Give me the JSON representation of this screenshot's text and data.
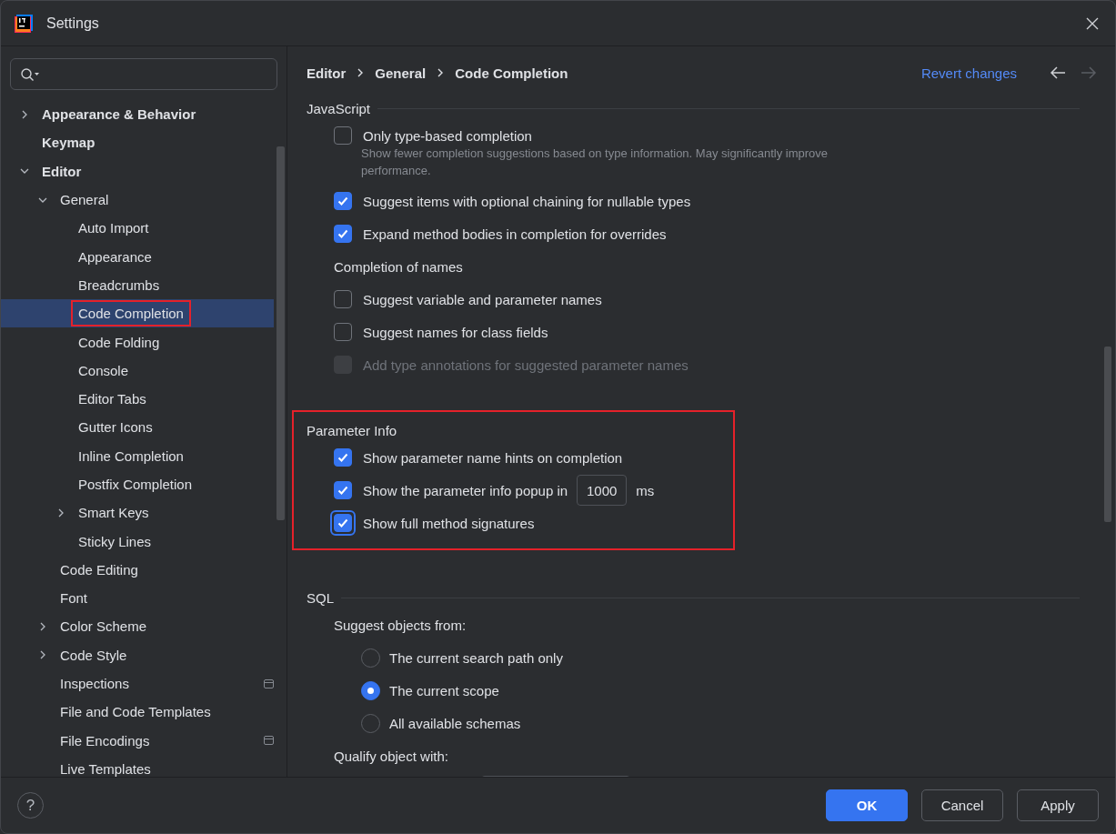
{
  "window": {
    "title": "Settings"
  },
  "sidebar": {
    "items": [
      {
        "label": "Appearance & Behavior",
        "selected": false,
        "highlighted": false,
        "project_scope": false,
        "expanded": false
      },
      {
        "label": "Keymap",
        "selected": false,
        "highlighted": false,
        "project_scope": false
      },
      {
        "label": "Editor",
        "selected": false,
        "highlighted": false,
        "project_scope": false,
        "expanded": true,
        "children": [
          {
            "label": "General",
            "selected": false,
            "highlighted": false,
            "project_scope": false,
            "expanded": true,
            "children": [
              {
                "label": "Auto Import",
                "selected": false,
                "highlighted": false,
                "project_scope": false
              },
              {
                "label": "Appearance",
                "selected": false,
                "highlighted": false,
                "project_scope": false
              },
              {
                "label": "Breadcrumbs",
                "selected": false,
                "highlighted": false,
                "project_scope": false
              },
              {
                "label": "Code Completion",
                "selected": true,
                "highlighted": true,
                "project_scope": false
              },
              {
                "label": "Code Folding",
                "selected": false,
                "highlighted": false,
                "project_scope": false
              },
              {
                "label": "Console",
                "selected": false,
                "highlighted": false,
                "project_scope": false
              },
              {
                "label": "Editor Tabs",
                "selected": false,
                "highlighted": false,
                "project_scope": false
              },
              {
                "label": "Gutter Icons",
                "selected": false,
                "highlighted": false,
                "project_scope": false
              },
              {
                "label": "Inline Completion",
                "selected": false,
                "highlighted": false,
                "project_scope": false
              },
              {
                "label": "Postfix Completion",
                "selected": false,
                "highlighted": false,
                "project_scope": false
              },
              {
                "label": "Smart Keys",
                "selected": false,
                "highlighted": false,
                "project_scope": false,
                "expanded": false
              },
              {
                "label": "Sticky Lines",
                "selected": false,
                "highlighted": false,
                "project_scope": false
              }
            ]
          },
          {
            "label": "Code Editing",
            "selected": false,
            "highlighted": false,
            "project_scope": false
          },
          {
            "label": "Font",
            "selected": false,
            "highlighted": false,
            "project_scope": false
          },
          {
            "label": "Color Scheme",
            "selected": false,
            "highlighted": false,
            "project_scope": false,
            "expanded": false
          },
          {
            "label": "Code Style",
            "selected": false,
            "highlighted": false,
            "project_scope": false,
            "expanded": false
          },
          {
            "label": "Inspections",
            "selected": false,
            "highlighted": false,
            "project_scope": true
          },
          {
            "label": "File and Code Templates",
            "selected": false,
            "highlighted": false,
            "project_scope": false
          },
          {
            "label": "File Encodings",
            "selected": false,
            "highlighted": false,
            "project_scope": true
          },
          {
            "label": "Live Templates",
            "selected": false,
            "highlighted": false,
            "project_scope": false
          }
        ]
      }
    ]
  },
  "breadcrumbs": [
    "Editor",
    "General",
    "Code Completion"
  ],
  "revert_link": "Revert changes",
  "nav": {
    "back_enabled": true,
    "forward_enabled": false
  },
  "sections": [
    {
      "title": "JavaScript",
      "highlighted": false,
      "rows": [
        {
          "kind": "checkbox",
          "label": "Only type-based completion",
          "checked": false,
          "disabled": false,
          "focused": false,
          "description": "Show fewer completion suggestions based on type information. May significantly improve performance."
        },
        {
          "kind": "checkbox",
          "label": "Suggest items with optional chaining for nullable types",
          "checked": true,
          "disabled": false,
          "focused": false
        },
        {
          "kind": "checkbox",
          "label": "Expand method bodies in completion for overrides",
          "checked": true,
          "disabled": false,
          "focused": false
        },
        {
          "kind": "subheading",
          "label": "Completion of names"
        },
        {
          "kind": "checkbox",
          "label": "Suggest variable and parameter names",
          "checked": false,
          "disabled": false,
          "focused": false
        },
        {
          "kind": "checkbox",
          "label": "Suggest names for class fields",
          "checked": false,
          "disabled": false,
          "focused": false
        },
        {
          "kind": "checkbox",
          "label": "Add type annotations for suggested parameter names",
          "checked": false,
          "disabled": true,
          "focused": false
        }
      ]
    },
    {
      "title": "Parameter Info",
      "highlighted": true,
      "rows": [
        {
          "kind": "checkbox",
          "label": "Show parameter name hints on completion",
          "checked": true,
          "disabled": false,
          "focused": false
        },
        {
          "kind": "checkbox",
          "label": "Show the parameter info popup in",
          "checked": true,
          "disabled": false,
          "focused": false,
          "field_value": "1000",
          "unit": "ms"
        },
        {
          "kind": "checkbox",
          "label": "Show full method signatures",
          "checked": true,
          "disabled": false,
          "focused": true
        }
      ]
    },
    {
      "title": "SQL",
      "highlighted": false,
      "rows": [
        {
          "kind": "subheading",
          "label": "Suggest objects from:"
        },
        {
          "kind": "radio",
          "label": "The current search path only",
          "selected": false
        },
        {
          "kind": "radio",
          "label": "The current scope",
          "selected": true
        },
        {
          "kind": "radio",
          "label": "All available schemas",
          "selected": false
        },
        {
          "kind": "subheading",
          "label": "Qualify object with:"
        },
        {
          "kind": "dropdown"
        }
      ]
    }
  ],
  "footer": {
    "help": "?",
    "buttons": [
      {
        "label": "OK",
        "primary": true
      },
      {
        "label": "Cancel",
        "primary": false
      },
      {
        "label": "Apply",
        "primary": false
      }
    ]
  }
}
